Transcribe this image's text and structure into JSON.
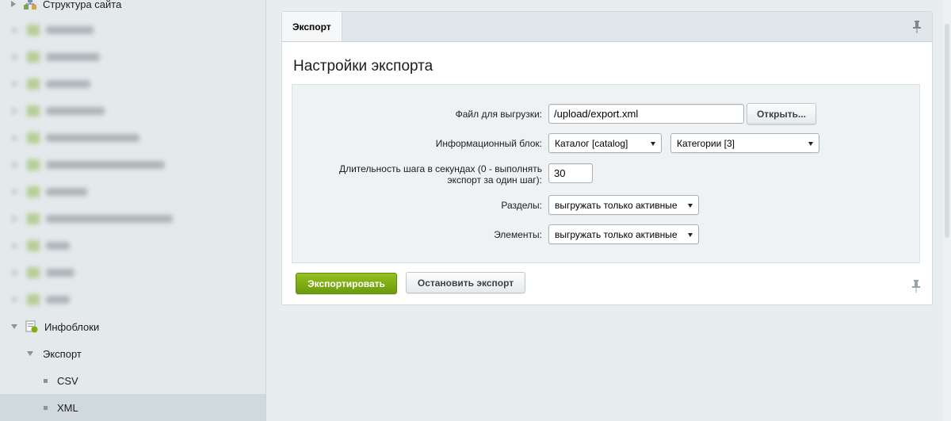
{
  "sidebar": {
    "site_structure": "Структура сайта",
    "iblocks": "Инфоблоки",
    "export": "Экспорт",
    "csv": "CSV",
    "xml": "XML",
    "blurred_count": 11
  },
  "tabs": [
    {
      "label": "Экспорт",
      "active": true
    }
  ],
  "panel": {
    "title": "Настройки экспорта"
  },
  "form": {
    "file_label": "Файл для выгрузки:",
    "file_value": "/upload/export.xml",
    "open_button": "Открыть...",
    "iblock_label": "Информационный блок:",
    "iblock_type_value": "Каталог [catalog]",
    "iblock_value": "Категории [3]",
    "step_label_line1": "Длительность шага в секундах (0 - выполнять",
    "step_label_line2": "экспорт за один шаг):",
    "step_value": "30",
    "sections_label": "Разделы:",
    "sections_value": "выгружать только активные",
    "elements_label": "Элементы:",
    "elements_value": "выгружать только активные"
  },
  "actions": {
    "export_button": "Экспортировать",
    "stop_button": "Остановить экспорт"
  },
  "colors": {
    "accent_green": "#7fae14",
    "sidebar_bg": "#e4e9eb",
    "selected_row": "#cfd9de"
  }
}
